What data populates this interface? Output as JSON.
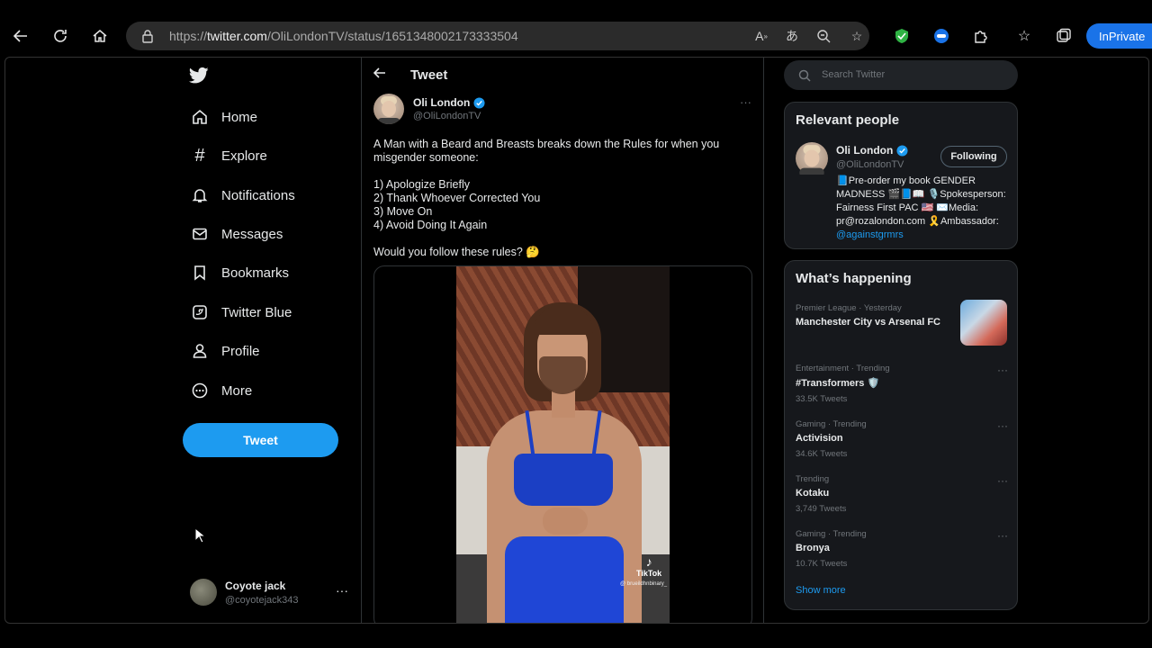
{
  "browser": {
    "url_prefix": "https://",
    "url_host": "twitter.com",
    "url_path": "/OliLondonTV/status/1651348002173333504",
    "inprivate_label": "InPrivate"
  },
  "sidebar": {
    "items": [
      {
        "label": "Home",
        "icon": "home-icon"
      },
      {
        "label": "Explore",
        "icon": "hashtag-icon"
      },
      {
        "label": "Notifications",
        "icon": "bell-icon"
      },
      {
        "label": "Messages",
        "icon": "envelope-icon"
      },
      {
        "label": "Bookmarks",
        "icon": "bookmark-icon"
      },
      {
        "label": "Twitter Blue",
        "icon": "twitter-blue-icon"
      },
      {
        "label": "Profile",
        "icon": "person-icon"
      },
      {
        "label": "More",
        "icon": "more-circle-icon"
      }
    ],
    "tweet_button": "Tweet",
    "account": {
      "name": "Coyote jack",
      "handle": "@coyotejack343",
      "menu": "···"
    }
  },
  "main": {
    "header_title": "Tweet",
    "author": {
      "name": "Oli London",
      "handle": "@OliLondonTV"
    },
    "post_menu": "···",
    "text": {
      "line1": "A Man with a Beard and Breasts breaks down the Rules for when you",
      "line2": "misgender someone:",
      "rule1": "1) Apologize Briefly",
      "rule2": "2) Thank Whoever Corrected You",
      "rule3": "3) Move On",
      "rule4": "4) Avoid Doing It Again",
      "question": "Would you follow these rules? 🤔"
    },
    "media": {
      "watermark": "TikTok",
      "watermark_handle": "@ brueildhnbinary_"
    }
  },
  "right": {
    "search_placeholder": "Search Twitter",
    "relevant": {
      "title": "Relevant people",
      "name": "Oli London",
      "handle": "@OliLondonTV",
      "follow_label": "Following",
      "bio_line1": "📘Pre-order my book GENDER",
      "bio_line2": "MADNESS 🎬📘📖 🎙️Spokesperson:",
      "bio_line3": "Fairness First PAC 🇺🇸 ✉️Media:",
      "bio_line4": "pr@rozalondon.com 🎗️Ambassador:",
      "bio_link": "@againstgrmrs"
    },
    "happening": {
      "title": "What’s happening",
      "trends": [
        {
          "context": "Premier League · Yesterday",
          "title": "Manchester City vs Arsenal FC",
          "count": ""
        },
        {
          "context": "Entertainment · Trending",
          "title": "#Transformers 🛡️",
          "count": "33.5K Tweets"
        },
        {
          "context": "Gaming · Trending",
          "title": "Activision",
          "count": "34.6K Tweets"
        },
        {
          "context": "Trending",
          "title": "Kotaku",
          "count": "3,749 Tweets"
        },
        {
          "context": "Gaming · Trending",
          "title": "Bronya",
          "count": "10.7K Tweets"
        }
      ],
      "trend_menu": "···",
      "show_more": "Show more"
    }
  },
  "colors": {
    "accent": "#1d9bf0",
    "background": "#000000",
    "panel": "#16181c",
    "muted": "#71767b",
    "text": "#e7e9ea"
  }
}
